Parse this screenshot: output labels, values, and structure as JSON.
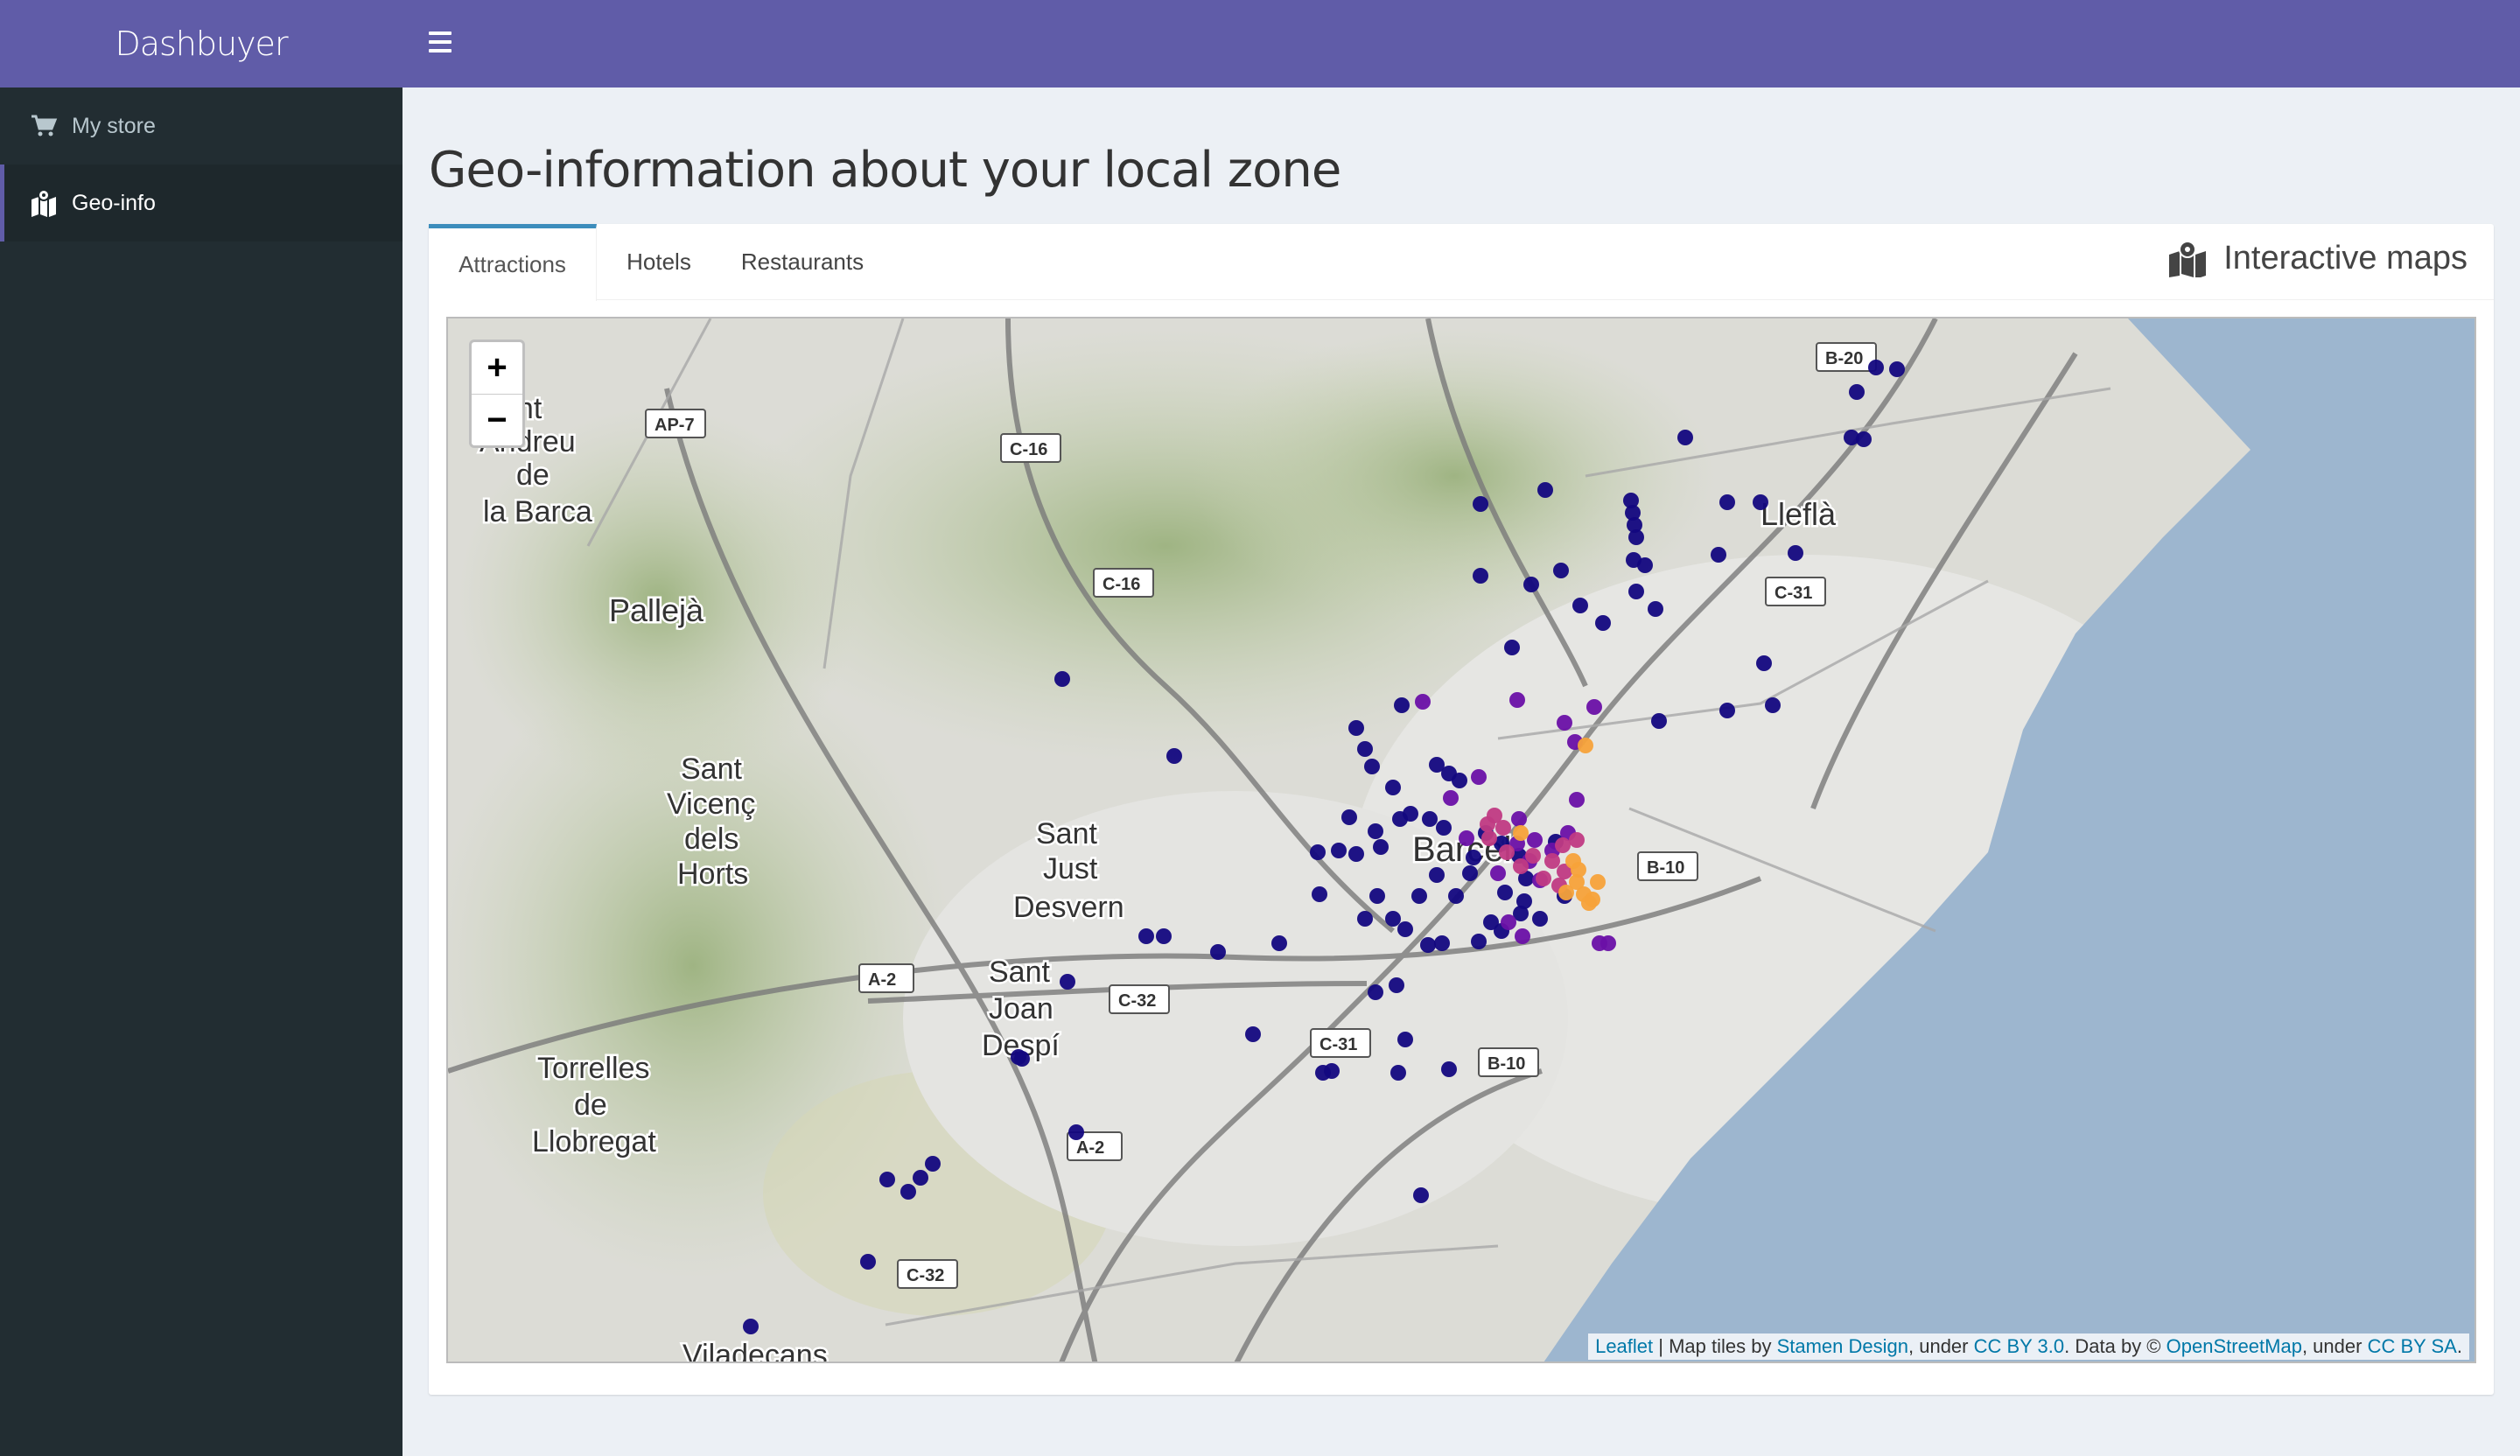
{
  "app": {
    "title": "Dashbuyer"
  },
  "sidebar": {
    "items": [
      {
        "label": "My store",
        "icon": "cart-icon"
      },
      {
        "label": "Geo-info",
        "icon": "map-marked-icon",
        "active": true
      }
    ]
  },
  "page": {
    "title": "Geo-information about your local zone"
  },
  "tabs": [
    {
      "label": "Attractions",
      "active": true
    },
    {
      "label": "Hotels"
    },
    {
      "label": "Restaurants"
    }
  ],
  "maps_header": {
    "label": "Interactive maps",
    "icon": "map-marked-icon"
  },
  "map": {
    "zoom_in": "+",
    "zoom_out": "−",
    "places": [
      {
        "label": "ant",
        "line2": "Andreu",
        "line3": "de",
        "line4": "la Barca"
      },
      {
        "label": "Pallejà"
      },
      {
        "label": "Sant",
        "line2": "Vicenç",
        "line3": "dels",
        "line4": "Horts"
      },
      {
        "label": "Sant",
        "line2": "Just",
        "line3": "Desvern"
      },
      {
        "label": "Sant",
        "line2": "Joan",
        "line3": "Despí"
      },
      {
        "label": "Torrelles",
        "line2": "de",
        "line3": "Llobregat"
      },
      {
        "label": "Lleflà"
      },
      {
        "label": "Barcel"
      },
      {
        "label": "Viladecans"
      }
    ],
    "road_labels": [
      "AP-7",
      "C-16",
      "C-16",
      "B-20",
      "C-31",
      "B-10",
      "A-2",
      "C-32",
      "C-31",
      "B-10",
      "A-2",
      "C-32"
    ],
    "attribution": {
      "leaflet": "Leaflet",
      "sep1": " | Map tiles by ",
      "stamen": "Stamen Design",
      "sep2": ", under ",
      "ccby": "CC BY 3.0",
      "sep3": ". Data by © ",
      "osm": "OpenStreetMap",
      "sep4": ", under ",
      "ccbysa": "CC BY SA",
      "end": "."
    },
    "colors": {
      "sea": "#9db6cf",
      "land": "#e8e8e4",
      "marker_low": "#13077f",
      "marker_mid": "#6a10a6",
      "marker_high": "#c03a83",
      "marker_peak": "#f7a23a"
    }
  }
}
